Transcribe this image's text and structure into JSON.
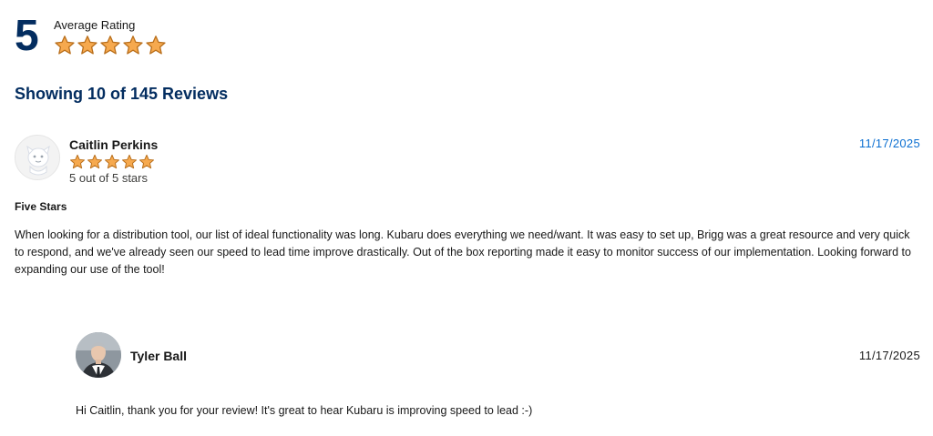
{
  "summary": {
    "average": "5",
    "average_label": "Average Rating",
    "rating_value": 5,
    "rating_max": 5
  },
  "showing_text": "Showing 10 of 145 Reviews",
  "review": {
    "reviewer": "Caitlin Perkins",
    "rating_value": 5,
    "rating_text": "5 out of 5 stars",
    "date": "11/17/2025",
    "title": "Five Stars",
    "body": "When looking for a distribution tool, our list of ideal functionality was long. Kubaru does everything we need/want. It was easy to set up, Brigg was a great resource and very quick to respond, and we've already seen our speed to lead time improve drastically. Out of the box reporting made it easy to monitor success of our implementation. Looking forward to expanding our use of the tool!",
    "avatar_icon": "default-user-avatar-icon"
  },
  "reply": {
    "name": "Tyler Ball",
    "date": "11/17/2025",
    "body": "Hi Caitlin, thank you for your review! It's great to hear Kubaru is improving speed to lead :-)",
    "avatar_icon": "user-photo-avatar"
  },
  "colors": {
    "heading": "#032d60",
    "star_fill": "#f6a94e",
    "star_stroke": "#b96f1c",
    "date_link": "#0b6fd1"
  }
}
